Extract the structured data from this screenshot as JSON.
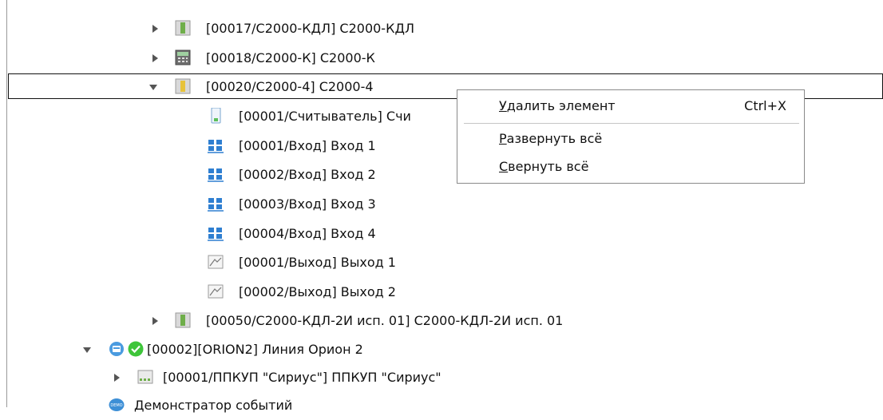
{
  "tree": {
    "rows": [
      {
        "label": "[00017/С2000-КДЛ] С2000-КДЛ",
        "icon": "green-device-icon",
        "expander": "collapsed"
      },
      {
        "label": "[00018/С2000-К] С2000-К",
        "icon": "keypad-device-icon",
        "expander": "collapsed"
      },
      {
        "label": "[00020/С2000-4] С2000-4",
        "icon": "yellow-device-icon",
        "expander": "expanded",
        "selected": true
      },
      {
        "label": "[00001/Считыватель] Счи",
        "icon": "reader-icon"
      },
      {
        "label": "[00001/Вход] Вход 1",
        "icon": "input-icon"
      },
      {
        "label": "[00002/Вход] Вход 2",
        "icon": "input-icon"
      },
      {
        "label": "[00003/Вход] Вход 3",
        "icon": "input-icon"
      },
      {
        "label": "[00004/Вход] Вход 4",
        "icon": "input-icon"
      },
      {
        "label": "[00001/Выход] Выход 1",
        "icon": "output-icon"
      },
      {
        "label": "[00002/Выход] Выход 2",
        "icon": "output-icon"
      },
      {
        "label": "[00050/С2000-КДЛ-2И исп. 01] С2000-КДЛ-2И исп. 01",
        "icon": "green-device-icon",
        "expander": "collapsed"
      },
      {
        "label": "[00002][ORION2] Линия Орион 2",
        "icon": "line-icon",
        "status_icon": "ok-check-icon",
        "expander": "expanded"
      },
      {
        "label": "[00001/ППКУП \"Сириус\"] ППКУП \"Сириус\"",
        "icon": "panel-device-icon",
        "expander": "collapsed"
      },
      {
        "label": "Демонстратор событий",
        "icon": "demo-icon"
      }
    ]
  },
  "context_menu": {
    "items": [
      {
        "label": "Удалить элемент",
        "shortcut": "Ctrl+X",
        "mnemonic": "У"
      },
      {
        "label": "Развернуть всё",
        "shortcut": "",
        "mnemonic": "Р"
      },
      {
        "label": "Свернуть всё",
        "shortcut": "",
        "mnemonic": "С"
      }
    ]
  },
  "colors": {
    "device_green": "#6fae4a",
    "device_yellow": "#e7c33b",
    "input_blue": "#2f7fd1",
    "ok_green": "#3ec53a",
    "line_blue": "#4a9be0"
  }
}
